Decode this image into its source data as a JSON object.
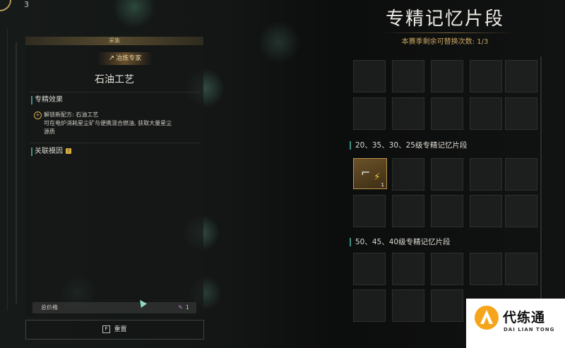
{
  "hud": {
    "top_count": "3"
  },
  "left_panel": {
    "category": "采集",
    "badge_label": "冶炼专家",
    "skill_title": "石油工艺",
    "effects_title": "专精效果",
    "effect_line1": "解锁新配方: 石油工艺",
    "effect_line2": "可在电炉消耗星尘矿与便携混合燃油, 获取大量星尘",
    "effect_line3": "源质",
    "related_title": "关联模因",
    "related_icon_glyph": "!",
    "price_label": "总价格",
    "price_value": "1",
    "reset_key": "F",
    "reset_label": "重置"
  },
  "right_panel": {
    "title": "专精记忆片段",
    "subtitle": "本赛季剩余可替换次数: 1/3",
    "section1_title": "20、35、30、25级专精记忆片段",
    "section2_title": "50、45、40级专精记忆片段",
    "fragment_count": "1"
  },
  "watermark": {
    "name_cn": "代练通",
    "name_en": "DAI LIAN TONG"
  },
  "colors": {
    "gold_accent": "#c9a660",
    "teal_accent": "#3f8f86",
    "logo_orange": "#f6a51b"
  },
  "icons": [
    "hammer-icon",
    "effect-star-icon",
    "warning-icon",
    "pencil-icon",
    "cursor-icon",
    "gun-icon",
    "lightning-icon",
    "logo-mark-icon"
  ]
}
